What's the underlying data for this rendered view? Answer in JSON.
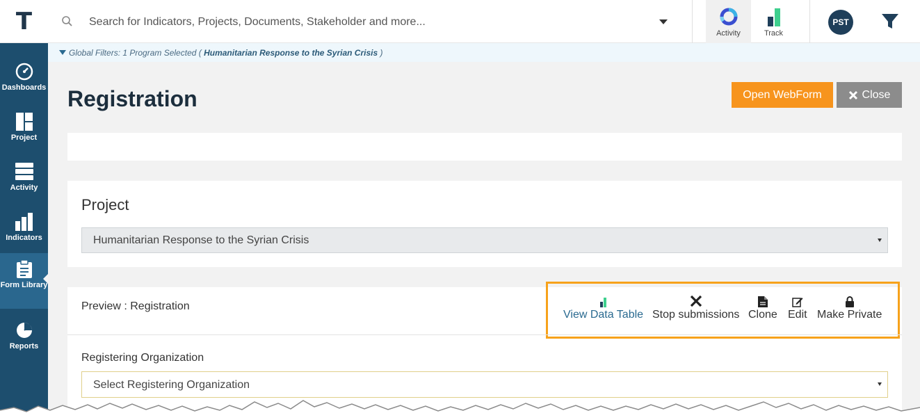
{
  "logo": "T",
  "search": {
    "placeholder": "Search for Indicators, Projects, Documents, Stakeholder and more..."
  },
  "apps": [
    {
      "label": "Activity",
      "icon": "activity-ring-icon",
      "active": true
    },
    {
      "label": "Track",
      "icon": "track-bars-icon",
      "active": false
    }
  ],
  "user": {
    "initials": "PST"
  },
  "sidebar": {
    "items": [
      {
        "label": "Dashboards",
        "icon": "dashboard-gauge-icon"
      },
      {
        "label": "Project",
        "icon": "project-grid-icon"
      },
      {
        "label": "Activity",
        "icon": "activity-stack-icon"
      },
      {
        "label": "Indicators",
        "icon": "indicators-bars-icon"
      },
      {
        "label": "Form Library",
        "icon": "clipboard-icon",
        "active": true
      },
      {
        "label": "Reports",
        "icon": "pie-chart-icon"
      }
    ]
  },
  "global_filter": {
    "prefix": "Global Filters: 1 Program Selected (",
    "program": "Humanitarian Response to the Syrian Crisis",
    "suffix": ")"
  },
  "page": {
    "title": "Registration",
    "open_webform_label": "Open WebForm",
    "close_label": "Close"
  },
  "project_card": {
    "label": "Project",
    "selected": "Humanitarian Response to the Syrian Crisis"
  },
  "preview_card": {
    "label": "Preview : Registration",
    "actions": [
      {
        "label": "View Data Table",
        "icon": "data-table-icon"
      },
      {
        "label": "Stop submissions",
        "icon": "x-icon"
      },
      {
        "label": "Clone",
        "icon": "document-icon"
      },
      {
        "label": "Edit",
        "icon": "edit-icon"
      },
      {
        "label": "Make Private",
        "icon": "lock-icon"
      }
    ],
    "highlight_color": "#f7a21b",
    "field_label": "Registering Organization",
    "field_placeholder": "Select Registering Organization"
  },
  "colors": {
    "sidebar": "#1d4e6e",
    "sidebar_active": "#2a678e",
    "accent_orange": "#f7941d",
    "close_grey": "#8c8c8c",
    "title": "#1c2e3d"
  }
}
